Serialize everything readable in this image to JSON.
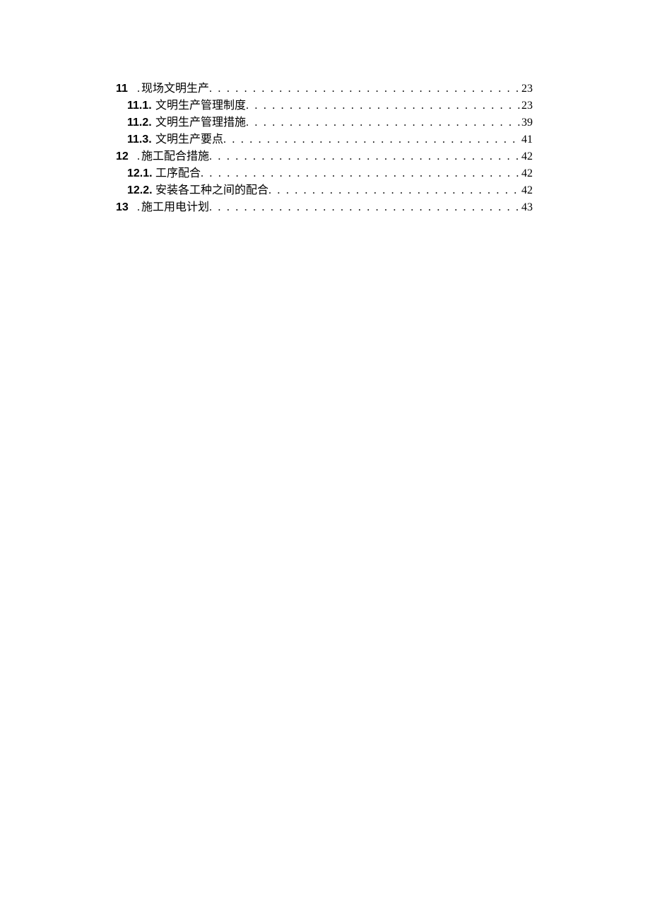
{
  "toc": [
    {
      "level": 1,
      "num": "11",
      "title": "现场文明生产",
      "gap": "",
      "page": "23"
    },
    {
      "level": 2,
      "num": "11.1.",
      "title": "文明生产管理制度",
      "gap": "",
      "page": "23"
    },
    {
      "level": 2,
      "num": "11.2.",
      "title": "文明生产管理措施",
      "gap": "",
      "page": "39"
    },
    {
      "level": 2,
      "num": "11.3.",
      "title": "文明生产要点",
      "gap": "",
      "page": "41"
    },
    {
      "level": 1,
      "num": "12",
      "title": "施工配合措施",
      "gap": " ",
      "page": "42"
    },
    {
      "level": 2,
      "num": "12.1.",
      "title": "工序配合",
      "gap": " ",
      "page": "42"
    },
    {
      "level": 2,
      "num": "12.2.",
      "title": "安装各工种之间的配合",
      "gap": " ",
      "page": "42"
    },
    {
      "level": 1,
      "num": "13",
      "title": "施工用电计划",
      "gap": " ",
      "page": "43"
    }
  ],
  "dot_prefix": "."
}
